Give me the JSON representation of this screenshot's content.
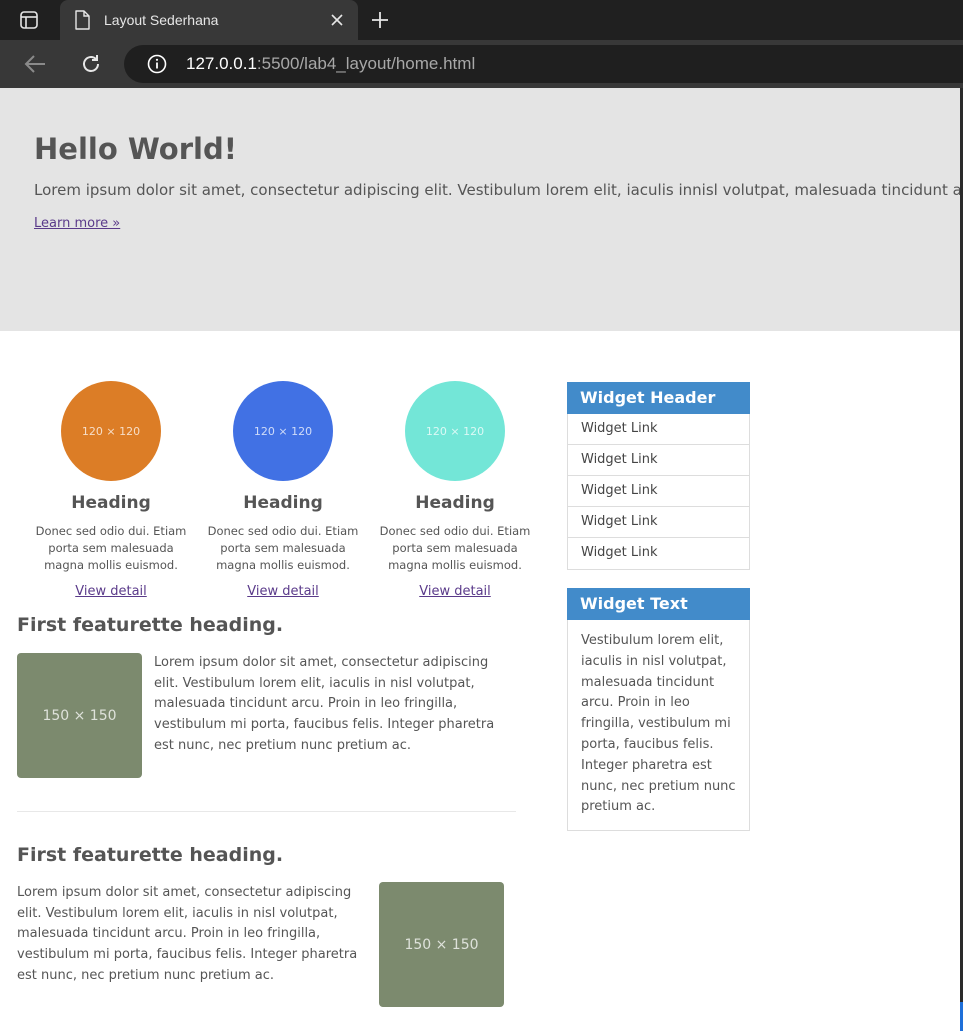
{
  "browser": {
    "tab_title": "Layout Sederhana",
    "url_host": "127.0.0.1",
    "url_rest": ":5500/lab4_layout/home.html"
  },
  "hero": {
    "title": "Hello World!",
    "text": "Lorem ipsum dolor sit amet, consectetur adipiscing elit. Vestibulum lorem elit, iaculis innisl volutpat, malesuada tincidunt arcu. Proin in",
    "link": "Learn more »"
  },
  "columns": [
    {
      "image_label": "120 × 120",
      "color": "#dc7d26",
      "heading": "Heading",
      "text": "Donec sed odio dui. Etiam porta sem malesuada magna mollis euismod.",
      "link": "View detail"
    },
    {
      "image_label": "120 × 120",
      "color": "#4171e4",
      "heading": "Heading",
      "text": "Donec sed odio dui. Etiam porta sem malesuada magna mollis euismod.",
      "link": "View detail"
    },
    {
      "image_label": "120 × 120",
      "color": "#73e6d7",
      "heading": "Heading",
      "text": "Donec sed odio dui. Etiam porta sem malesuada magna mollis euismod.",
      "link": "View detail"
    }
  ],
  "featurettes": [
    {
      "heading": "First featurette heading.",
      "image_label": "150 × 150",
      "text": "Lorem ipsum dolor sit amet, consectetur adipiscing elit. Vestibulum lorem elit, iaculis in nisl volutpat, malesuada tincidunt arcu. Proin in leo fringilla, vestibulum mi porta, faucibus felis. Integer pharetra est nunc, nec pretium nunc pretium ac."
    },
    {
      "heading": "First featurette heading.",
      "image_label": "150 × 150",
      "text": "Lorem ipsum dolor sit amet, consectetur adipiscing elit. Vestibulum lorem elit, iaculis in nisl volutpat, malesuada tincidunt arcu. Proin in leo fringilla, vestibulum mi porta, faucibus felis. Integer pharetra est nunc, nec pretium nunc pretium ac."
    }
  ],
  "sidebar": {
    "widget1": {
      "header": "Widget Header",
      "links": [
        "Widget Link",
        "Widget Link",
        "Widget Link",
        "Widget Link",
        "Widget Link"
      ]
    },
    "widget2": {
      "header": "Widget Text",
      "text": "Vestibulum lorem elit, iaculis in nisl volutpat, malesuada tincidunt arcu. Proin in leo fringilla, vestibulum mi porta, faucibus felis. Integer pharetra est nunc, nec pretium nunc pretium ac."
    }
  },
  "colors": {
    "accent": "#428bca",
    "placeholder": "#7c8a6e",
    "hero_bg": "#e4e4e4"
  }
}
